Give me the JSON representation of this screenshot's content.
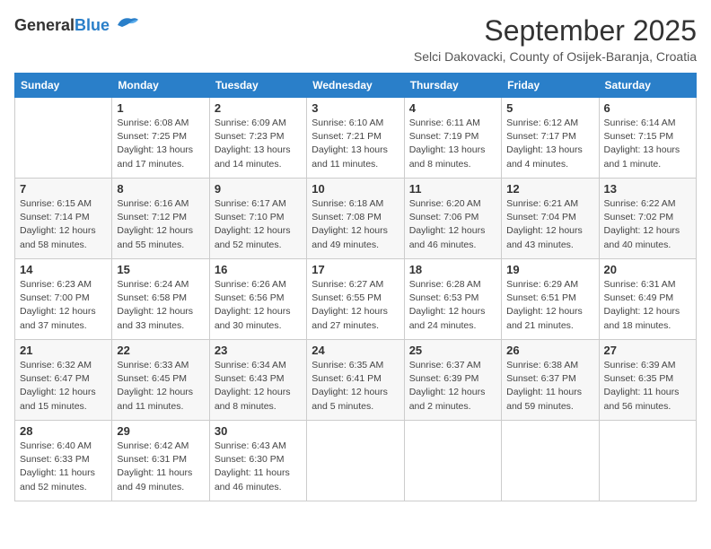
{
  "header": {
    "logo_general": "General",
    "logo_blue": "Blue",
    "title": "September 2025",
    "subtitle": "Selci Dakovacki, County of Osijek-Baranja, Croatia"
  },
  "columns": [
    "Sunday",
    "Monday",
    "Tuesday",
    "Wednesday",
    "Thursday",
    "Friday",
    "Saturday"
  ],
  "weeks": [
    [
      {
        "day": "",
        "info": ""
      },
      {
        "day": "1",
        "info": "Sunrise: 6:08 AM\nSunset: 7:25 PM\nDaylight: 13 hours\nand 17 minutes."
      },
      {
        "day": "2",
        "info": "Sunrise: 6:09 AM\nSunset: 7:23 PM\nDaylight: 13 hours\nand 14 minutes."
      },
      {
        "day": "3",
        "info": "Sunrise: 6:10 AM\nSunset: 7:21 PM\nDaylight: 13 hours\nand 11 minutes."
      },
      {
        "day": "4",
        "info": "Sunrise: 6:11 AM\nSunset: 7:19 PM\nDaylight: 13 hours\nand 8 minutes."
      },
      {
        "day": "5",
        "info": "Sunrise: 6:12 AM\nSunset: 7:17 PM\nDaylight: 13 hours\nand 4 minutes."
      },
      {
        "day": "6",
        "info": "Sunrise: 6:14 AM\nSunset: 7:15 PM\nDaylight: 13 hours\nand 1 minute."
      }
    ],
    [
      {
        "day": "7",
        "info": "Sunrise: 6:15 AM\nSunset: 7:14 PM\nDaylight: 12 hours\nand 58 minutes."
      },
      {
        "day": "8",
        "info": "Sunrise: 6:16 AM\nSunset: 7:12 PM\nDaylight: 12 hours\nand 55 minutes."
      },
      {
        "day": "9",
        "info": "Sunrise: 6:17 AM\nSunset: 7:10 PM\nDaylight: 12 hours\nand 52 minutes."
      },
      {
        "day": "10",
        "info": "Sunrise: 6:18 AM\nSunset: 7:08 PM\nDaylight: 12 hours\nand 49 minutes."
      },
      {
        "day": "11",
        "info": "Sunrise: 6:20 AM\nSunset: 7:06 PM\nDaylight: 12 hours\nand 46 minutes."
      },
      {
        "day": "12",
        "info": "Sunrise: 6:21 AM\nSunset: 7:04 PM\nDaylight: 12 hours\nand 43 minutes."
      },
      {
        "day": "13",
        "info": "Sunrise: 6:22 AM\nSunset: 7:02 PM\nDaylight: 12 hours\nand 40 minutes."
      }
    ],
    [
      {
        "day": "14",
        "info": "Sunrise: 6:23 AM\nSunset: 7:00 PM\nDaylight: 12 hours\nand 37 minutes."
      },
      {
        "day": "15",
        "info": "Sunrise: 6:24 AM\nSunset: 6:58 PM\nDaylight: 12 hours\nand 33 minutes."
      },
      {
        "day": "16",
        "info": "Sunrise: 6:26 AM\nSunset: 6:56 PM\nDaylight: 12 hours\nand 30 minutes."
      },
      {
        "day": "17",
        "info": "Sunrise: 6:27 AM\nSunset: 6:55 PM\nDaylight: 12 hours\nand 27 minutes."
      },
      {
        "day": "18",
        "info": "Sunrise: 6:28 AM\nSunset: 6:53 PM\nDaylight: 12 hours\nand 24 minutes."
      },
      {
        "day": "19",
        "info": "Sunrise: 6:29 AM\nSunset: 6:51 PM\nDaylight: 12 hours\nand 21 minutes."
      },
      {
        "day": "20",
        "info": "Sunrise: 6:31 AM\nSunset: 6:49 PM\nDaylight: 12 hours\nand 18 minutes."
      }
    ],
    [
      {
        "day": "21",
        "info": "Sunrise: 6:32 AM\nSunset: 6:47 PM\nDaylight: 12 hours\nand 15 minutes."
      },
      {
        "day": "22",
        "info": "Sunrise: 6:33 AM\nSunset: 6:45 PM\nDaylight: 12 hours\nand 11 minutes."
      },
      {
        "day": "23",
        "info": "Sunrise: 6:34 AM\nSunset: 6:43 PM\nDaylight: 12 hours\nand 8 minutes."
      },
      {
        "day": "24",
        "info": "Sunrise: 6:35 AM\nSunset: 6:41 PM\nDaylight: 12 hours\nand 5 minutes."
      },
      {
        "day": "25",
        "info": "Sunrise: 6:37 AM\nSunset: 6:39 PM\nDaylight: 12 hours\nand 2 minutes."
      },
      {
        "day": "26",
        "info": "Sunrise: 6:38 AM\nSunset: 6:37 PM\nDaylight: 11 hours\nand 59 minutes."
      },
      {
        "day": "27",
        "info": "Sunrise: 6:39 AM\nSunset: 6:35 PM\nDaylight: 11 hours\nand 56 minutes."
      }
    ],
    [
      {
        "day": "28",
        "info": "Sunrise: 6:40 AM\nSunset: 6:33 PM\nDaylight: 11 hours\nand 52 minutes."
      },
      {
        "day": "29",
        "info": "Sunrise: 6:42 AM\nSunset: 6:31 PM\nDaylight: 11 hours\nand 49 minutes."
      },
      {
        "day": "30",
        "info": "Sunrise: 6:43 AM\nSunset: 6:30 PM\nDaylight: 11 hours\nand 46 minutes."
      },
      {
        "day": "",
        "info": ""
      },
      {
        "day": "",
        "info": ""
      },
      {
        "day": "",
        "info": ""
      },
      {
        "day": "",
        "info": ""
      }
    ]
  ]
}
